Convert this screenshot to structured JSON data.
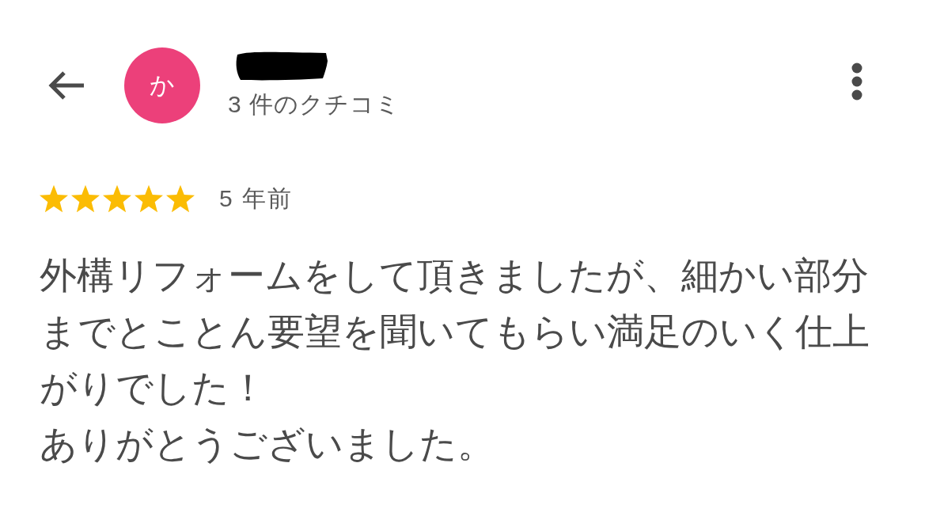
{
  "header": {
    "avatar": {
      "initial": "か"
    },
    "reviewer": {
      "redacted": true
    },
    "review_count": "3 件のクチコミ"
  },
  "review": {
    "stars": 5,
    "time": "5 年前",
    "paragraphs": [
      "外構リフォームをして頂きましたが、細かい部分までとことん要望を聞いてもらい満足のいく仕上がりでした！",
      "ありがとうございました。"
    ]
  }
}
